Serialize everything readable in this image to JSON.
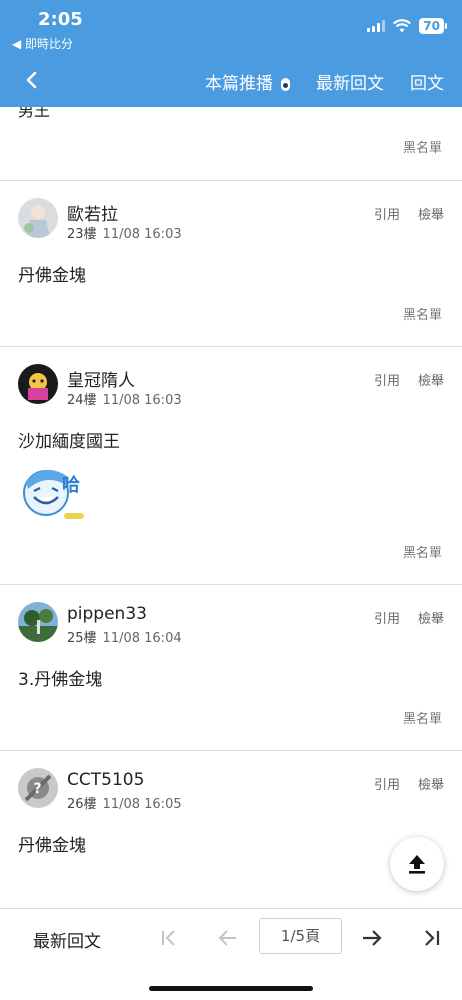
{
  "status_bar": {
    "time": "2:05",
    "back_label": "◀ 即時比分",
    "battery": "70"
  },
  "nav": {
    "recommend_label": "本篇推播",
    "latest_label": "最新回文",
    "reply_label": "回文"
  },
  "partial_post": {
    "text": "男王",
    "blacklist": "黑名單"
  },
  "posts": [
    {
      "username": "歐若拉",
      "floor": "23樓",
      "time": "11/08 16:03",
      "text": "丹佛金塊",
      "quote": "引用",
      "report": "檢舉",
      "blacklist": "黑名單"
    },
    {
      "username": "皇冠隋人",
      "floor": "24樓",
      "time": "11/08 16:03",
      "text": "沙加緬度國王",
      "sticker": "哈",
      "quote": "引用",
      "report": "檢舉",
      "blacklist": "黑名單"
    },
    {
      "username": "pippen33",
      "floor": "25樓",
      "time": "11/08 16:04",
      "text": "3.丹佛金塊",
      "quote": "引用",
      "report": "檢舉",
      "blacklist": "黑名單"
    },
    {
      "username": "CCT5105",
      "floor": "26樓",
      "time": "11/08 16:05",
      "text": "丹佛金塊",
      "quote": "引用",
      "report": "檢舉",
      "blacklist": "黑名單"
    }
  ],
  "bottom": {
    "latest_label": "最新回文",
    "page_indicator": "1/5頁"
  },
  "colors": {
    "header": "#4a9be0",
    "divider": "#dcdcdc"
  }
}
